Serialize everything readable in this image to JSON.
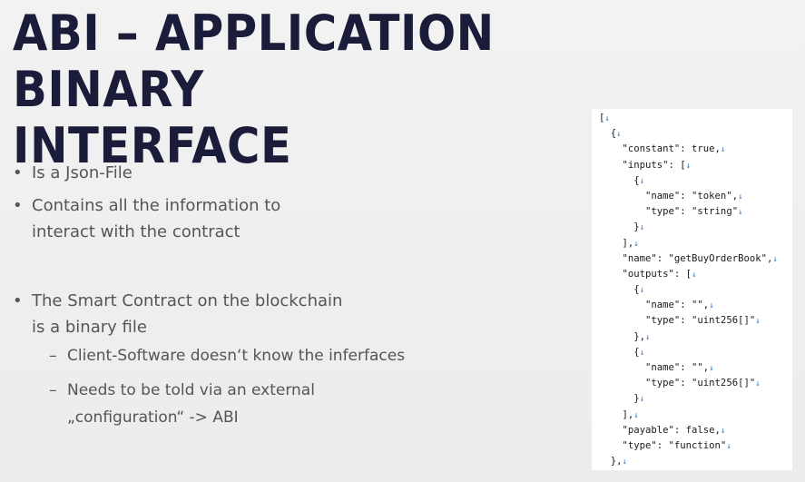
{
  "slide": {
    "title_line1": "ABI – APPLICATION BINARY",
    "title_line2": "INTERFACE",
    "bullets": [
      {
        "line1": "Is a Json-File",
        "line2": ""
      },
      {
        "line1": "Contains all the information to",
        "line2": "interact with the contract"
      },
      {
        "line1": "The Smart Contract on the blockchain",
        "line2": "is a binary file"
      }
    ],
    "sub_bullets": [
      {
        "line1": "Client-Software doesn‘t know the inferfaces",
        "line2": ""
      },
      {
        "line1": "Needs to be told via an external",
        "line2": "„configuration“ -> ABI"
      }
    ],
    "bullet_glyph": "•",
    "sub_bullet_glyph": "–",
    "return_glyph": "↓"
  },
  "code_lines": [
    "[",
    "  {",
    "    \"constant\": true,",
    "    \"inputs\": [",
    "      {",
    "        \"name\": \"token\",",
    "        \"type\": \"string\"",
    "      }",
    "    ],",
    "    \"name\": \"getBuyOrderBook\",",
    "    \"outputs\": [",
    "      {",
    "        \"name\": \"\",",
    "        \"type\": \"uint256[]\"",
    "      },",
    "      {",
    "        \"name\": \"\",",
    "        \"type\": \"uint256[]\"",
    "      }",
    "    ],",
    "    \"payable\": false,",
    "    \"type\": \"function\"",
    "  },"
  ],
  "colors": {
    "title": "#1b1b3a",
    "body_text": "#555555",
    "return_mark": "#2f74c9",
    "background": "#efefef"
  }
}
